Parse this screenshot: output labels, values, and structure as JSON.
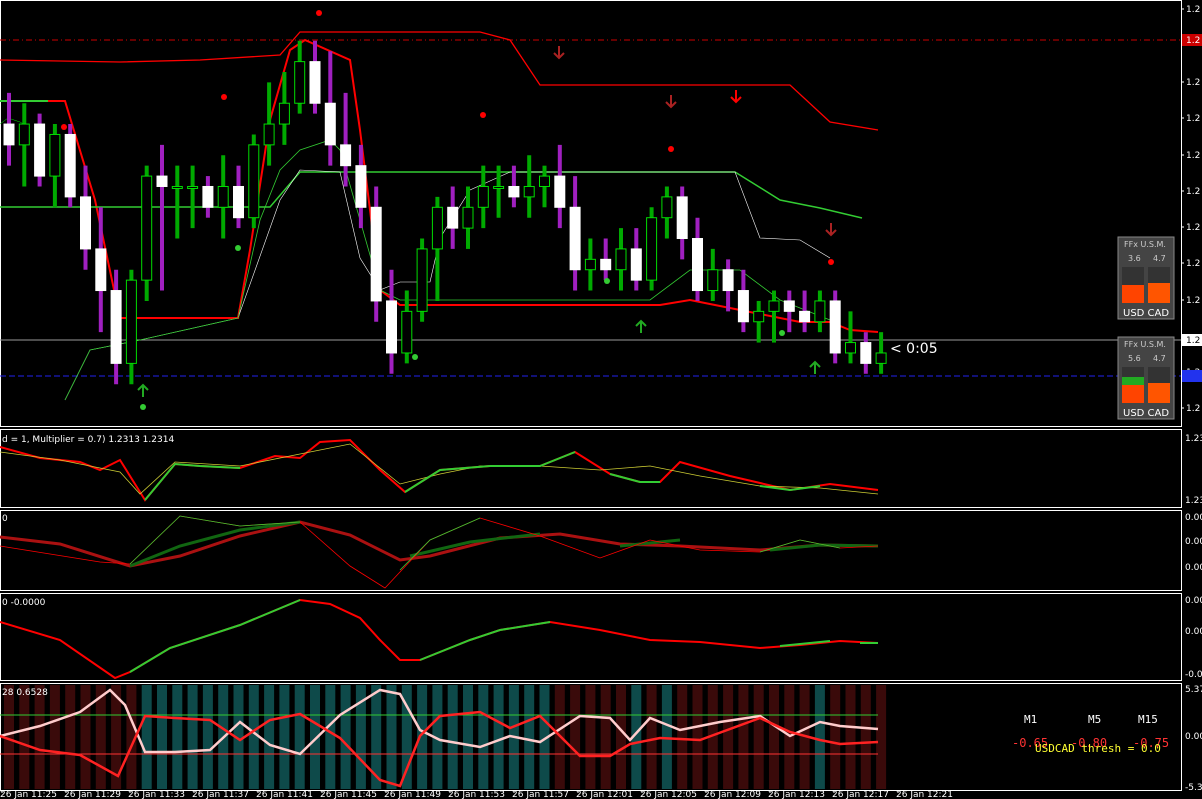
{
  "chart_data": [
    {
      "type": "candlestick",
      "panel": "main",
      "price_axis_labels": [
        "1.2",
        "1.2",
        "1.2",
        "1.2",
        "1.2",
        "1.2",
        "1.2",
        "1.2",
        "1.2",
        "1.2",
        "1.2",
        "1.2"
      ],
      "current_price_label": "1.2",
      "timer_label": "< 0:05",
      "candles": [
        {
          "o": 1.2326,
          "h": 1.2329,
          "l": 1.2322,
          "c": 1.2324
        },
        {
          "o": 1.2324,
          "h": 1.2328,
          "l": 1.232,
          "c": 1.2326
        },
        {
          "o": 1.2326,
          "h": 1.2327,
          "l": 1.232,
          "c": 1.2321
        },
        {
          "o": 1.2321,
          "h": 1.2326,
          "l": 1.2318,
          "c": 1.2325
        },
        {
          "o": 1.2325,
          "h": 1.2326,
          "l": 1.2318,
          "c": 1.2319
        },
        {
          "o": 1.2319,
          "h": 1.2322,
          "l": 1.2312,
          "c": 1.2314
        },
        {
          "o": 1.2314,
          "h": 1.2318,
          "l": 1.2306,
          "c": 1.231
        },
        {
          "o": 1.231,
          "h": 1.2312,
          "l": 1.2301,
          "c": 1.2303
        },
        {
          "o": 1.2303,
          "h": 1.2312,
          "l": 1.2301,
          "c": 1.2311
        },
        {
          "o": 1.2311,
          "h": 1.2322,
          "l": 1.2309,
          "c": 1.2321
        },
        {
          "o": 1.2321,
          "h": 1.2324,
          "l": 1.231,
          "c": 1.232
        },
        {
          "o": 1.232,
          "h": 1.2322,
          "l": 1.2315,
          "c": 1.232
        },
        {
          "o": 1.232,
          "h": 1.2322,
          "l": 1.2316,
          "c": 1.232
        },
        {
          "o": 1.232,
          "h": 1.2321,
          "l": 1.2317,
          "c": 1.2318
        },
        {
          "o": 1.2318,
          "h": 1.2323,
          "l": 1.2315,
          "c": 1.232
        },
        {
          "o": 1.232,
          "h": 1.2322,
          "l": 1.2316,
          "c": 1.2317
        },
        {
          "o": 1.2317,
          "h": 1.2325,
          "l": 1.2316,
          "c": 1.2324
        },
        {
          "o": 1.2324,
          "h": 1.233,
          "l": 1.2322,
          "c": 1.2326
        },
        {
          "o": 1.2326,
          "h": 1.2331,
          "l": 1.2324,
          "c": 1.2328
        },
        {
          "o": 1.2328,
          "h": 1.2334,
          "l": 1.2327,
          "c": 1.2332
        },
        {
          "o": 1.2332,
          "h": 1.2334,
          "l": 1.2327,
          "c": 1.2328
        },
        {
          "o": 1.2328,
          "h": 1.2333,
          "l": 1.2322,
          "c": 1.2324
        },
        {
          "o": 1.2324,
          "h": 1.2329,
          "l": 1.232,
          "c": 1.2322
        },
        {
          "o": 1.2322,
          "h": 1.2324,
          "l": 1.2316,
          "c": 1.2318
        },
        {
          "o": 1.2318,
          "h": 1.232,
          "l": 1.2307,
          "c": 1.2309
        },
        {
          "o": 1.2309,
          "h": 1.2312,
          "l": 1.2302,
          "c": 1.2304
        },
        {
          "o": 1.2304,
          "h": 1.231,
          "l": 1.2303,
          "c": 1.2308
        },
        {
          "o": 1.2308,
          "h": 1.2315,
          "l": 1.2307,
          "c": 1.2314
        },
        {
          "o": 1.2314,
          "h": 1.2319,
          "l": 1.2309,
          "c": 1.2318
        },
        {
          "o": 1.2318,
          "h": 1.232,
          "l": 1.2314,
          "c": 1.2316
        },
        {
          "o": 1.2316,
          "h": 1.232,
          "l": 1.2314,
          "c": 1.2318
        },
        {
          "o": 1.2318,
          "h": 1.2322,
          "l": 1.2316,
          "c": 1.232
        },
        {
          "o": 1.232,
          "h": 1.2322,
          "l": 1.2317,
          "c": 1.232
        },
        {
          "o": 1.232,
          "h": 1.2322,
          "l": 1.2318,
          "c": 1.2319
        },
        {
          "o": 1.2319,
          "h": 1.2323,
          "l": 1.2317,
          "c": 1.232
        },
        {
          "o": 1.232,
          "h": 1.2322,
          "l": 1.2318,
          "c": 1.2321
        },
        {
          "o": 1.2321,
          "h": 1.2324,
          "l": 1.2316,
          "c": 1.2318
        },
        {
          "o": 1.2318,
          "h": 1.2321,
          "l": 1.231,
          "c": 1.2312
        },
        {
          "o": 1.2312,
          "h": 1.2315,
          "l": 1.231,
          "c": 1.2313
        },
        {
          "o": 1.2313,
          "h": 1.2315,
          "l": 1.2311,
          "c": 1.2312
        },
        {
          "o": 1.2312,
          "h": 1.2316,
          "l": 1.231,
          "c": 1.2314
        },
        {
          "o": 1.2314,
          "h": 1.2316,
          "l": 1.231,
          "c": 1.2311
        },
        {
          "o": 1.2311,
          "h": 1.2318,
          "l": 1.231,
          "c": 1.2317
        },
        {
          "o": 1.2317,
          "h": 1.232,
          "l": 1.2315,
          "c": 1.2319
        },
        {
          "o": 1.2319,
          "h": 1.232,
          "l": 1.2313,
          "c": 1.2315
        },
        {
          "o": 1.2315,
          "h": 1.2317,
          "l": 1.2309,
          "c": 1.231
        },
        {
          "o": 1.231,
          "h": 1.2314,
          "l": 1.2309,
          "c": 1.2312
        },
        {
          "o": 1.2312,
          "h": 1.2313,
          "l": 1.2308,
          "c": 1.231
        },
        {
          "o": 1.231,
          "h": 1.2312,
          "l": 1.2306,
          "c": 1.2307
        },
        {
          "o": 1.2307,
          "h": 1.2309,
          "l": 1.2305,
          "c": 1.2308
        },
        {
          "o": 1.2308,
          "h": 1.231,
          "l": 1.2305,
          "c": 1.2309
        },
        {
          "o": 1.2309,
          "h": 1.231,
          "l": 1.2306,
          "c": 1.2308
        },
        {
          "o": 1.2308,
          "h": 1.231,
          "l": 1.2306,
          "c": 1.2307
        },
        {
          "o": 1.2307,
          "h": 1.231,
          "l": 1.2306,
          "c": 1.2309
        },
        {
          "o": 1.2309,
          "h": 1.231,
          "l": 1.2303,
          "c": 1.2304
        },
        {
          "o": 1.2304,
          "h": 1.2308,
          "l": 1.2303,
          "c": 1.2305
        },
        {
          "o": 1.2305,
          "h": 1.2306,
          "l": 1.2302,
          "c": 1.2303
        },
        {
          "o": 1.2303,
          "h": 1.2306,
          "l": 1.2302,
          "c": 1.2304
        }
      ]
    },
    {
      "type": "line",
      "panel": "indicator-1",
      "header": "d = 1, Multiplier = 0.7) 1.2313 1.2314",
      "axis_labels": [
        "1.23",
        "1.23"
      ]
    },
    {
      "type": "line",
      "panel": "indicator-2",
      "header": "0",
      "axis_labels": [
        "0.00",
        "0.00",
        "0.00"
      ]
    },
    {
      "type": "line",
      "panel": "indicator-3",
      "header": "0 -0.0000",
      "axis_labels": [
        "0.00",
        "0.00",
        "-0.00"
      ]
    },
    {
      "type": "line",
      "panel": "indicator-4",
      "header": "28 0.6528",
      "axis_labels": [
        "5.37",
        "0.00",
        "-5.37"
      ]
    }
  ],
  "time_labels": [
    "26 Jan 11:25",
    "26 Jan 11:29",
    "26 Jan 11:33",
    "26 Jan 11:37",
    "26 Jan 11:41",
    "26 Jan 11:45",
    "26 Jan 11:49",
    "26 Jan 11:53",
    "26 Jan 11:57",
    "26 Jan 12:01",
    "26 Jan 12:05",
    "26 Jan 12:09",
    "26 Jan 12:13",
    "26 Jan 12:17",
    "26 Jan 12:21"
  ],
  "usm_widgets": [
    {
      "title": "FFx U.S.M.",
      "vals": [
        "3.6",
        "4.7"
      ],
      "pair": "USD CAD"
    },
    {
      "title": "FFx U.S.M.",
      "vals": [
        "5.6",
        "4.7"
      ],
      "pair": "USD CAD"
    }
  ],
  "strength_table": {
    "headers": [
      "M1",
      "M5",
      "M15"
    ],
    "values": [
      "-0.65",
      "-0.80",
      "-0.75"
    ],
    "footer": "USDCAD thresh = 0.0"
  },
  "colors": {
    "bull": "#00ff00",
    "bear": "#ffffff",
    "red": "#ff0000",
    "green": "#33cc33",
    "purple": "#9900cc",
    "yellow": "#cccc33"
  }
}
